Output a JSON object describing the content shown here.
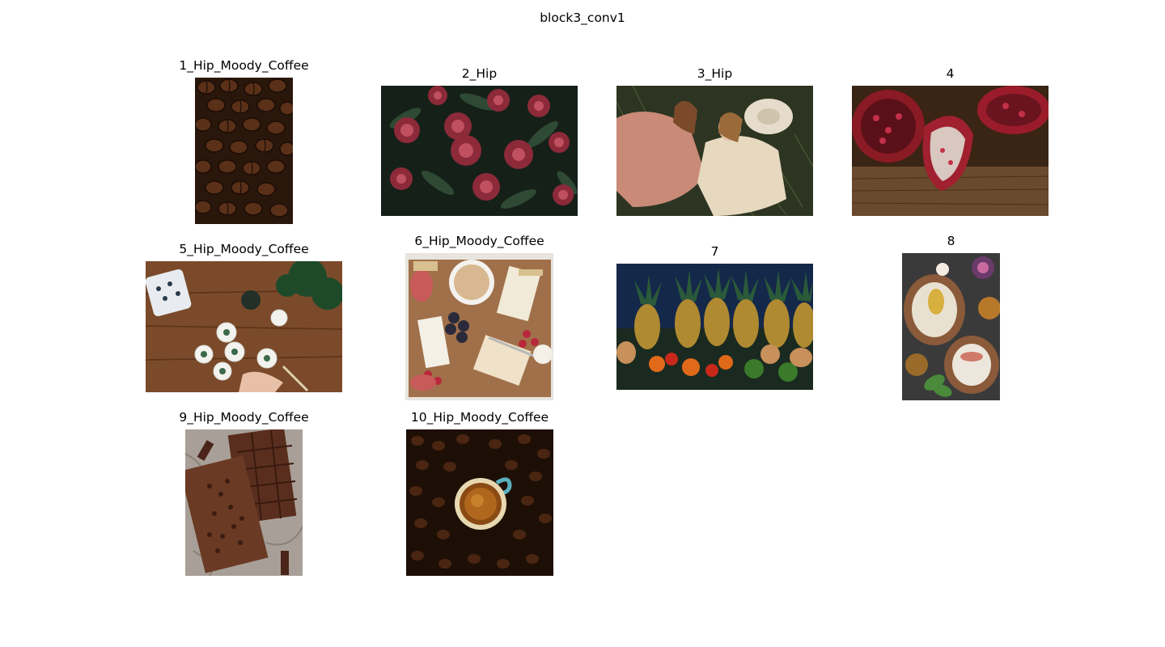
{
  "figure": {
    "title": "block3_conv1"
  },
  "panels": [
    {
      "title": "1_Hip_Moody_Coffee",
      "subject": "coffee beans"
    },
    {
      "title": "2_Hip",
      "subject": "red peonies"
    },
    {
      "title": "3_Hip",
      "subject": "two women lying in grass"
    },
    {
      "title": "4",
      "subject": "pomegranate halves"
    },
    {
      "title": "5_Hip_Moody_Coffee",
      "subject": "painting coasters on wood table"
    },
    {
      "title": "6_Hip_Moody_Coffee",
      "subject": "charcuterie board"
    },
    {
      "title": "7",
      "subject": "pineapples and tropical fruit"
    },
    {
      "title": "8",
      "subject": "smoothie bowls"
    },
    {
      "title": "9_Hip_Moody_Coffee",
      "subject": "chocolate bar"
    },
    {
      "title": "10_Hip_Moody_Coffee",
      "subject": "espresso cup on coffee beans"
    }
  ]
}
